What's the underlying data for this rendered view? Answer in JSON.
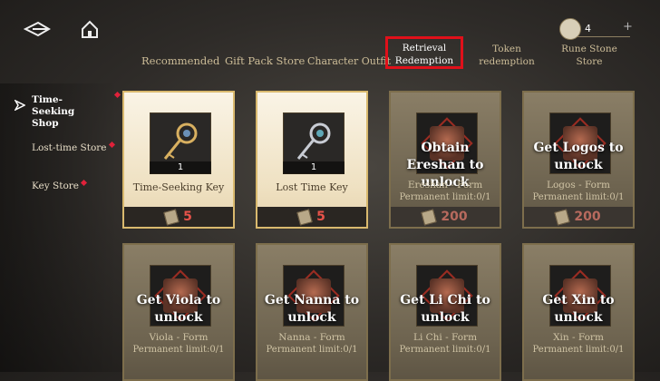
{
  "header": {
    "tabs": [
      {
        "label": "Recommended"
      },
      {
        "label": "Gift Pack Store"
      },
      {
        "label": "Character Outfit"
      },
      {
        "label": "Retrieval Redemption",
        "active": true
      },
      {
        "label": "Token redemption"
      },
      {
        "label": "Rune Stone Store"
      }
    ],
    "currency": {
      "amount": "4",
      "add": "+"
    },
    "icons": {
      "back": "back-arrow-icon",
      "home": "home-icon"
    }
  },
  "sidebar": {
    "items": [
      {
        "label": "Time-Seeking Shop",
        "active": true
      },
      {
        "label": "Lost-time Store"
      },
      {
        "label": "Key Store"
      }
    ]
  },
  "cards": [
    {
      "type": "buy",
      "name": "Time-Seeking Key",
      "qty": "1",
      "price": "5"
    },
    {
      "type": "buy",
      "name": "Lost Time Key",
      "qty": "1",
      "price": "5"
    },
    {
      "type": "locked",
      "overlay": "Obtain Ereshan to unlock",
      "name": "Ereshan - Form",
      "limit": "Permanent limit:0/1",
      "price": "200"
    },
    {
      "type": "locked",
      "overlay": "Get Logos to unlock",
      "name": "Logos - Form",
      "limit": "Permanent limit:0/1",
      "price": "200"
    },
    {
      "type": "locked",
      "overlay": "Get Viola to unlock",
      "name": "Viola - Form",
      "limit": "Permanent limit:0/1"
    },
    {
      "type": "locked",
      "overlay": "Get Nanna to unlock",
      "name": "Nanna - Form",
      "limit": "Permanent limit:0/1"
    },
    {
      "type": "locked",
      "overlay": "Get Li Chi to unlock",
      "name": "Li Chi - Form",
      "limit": "Permanent limit:0/1"
    },
    {
      "type": "locked",
      "overlay": "Get Xin to unlock",
      "name": "Xin - Form",
      "limit": "Permanent limit:0/1"
    }
  ],
  "colors": {
    "highlight": "#e0101a",
    "price": "#e8534a",
    "notify_dot": "#e0213a"
  }
}
